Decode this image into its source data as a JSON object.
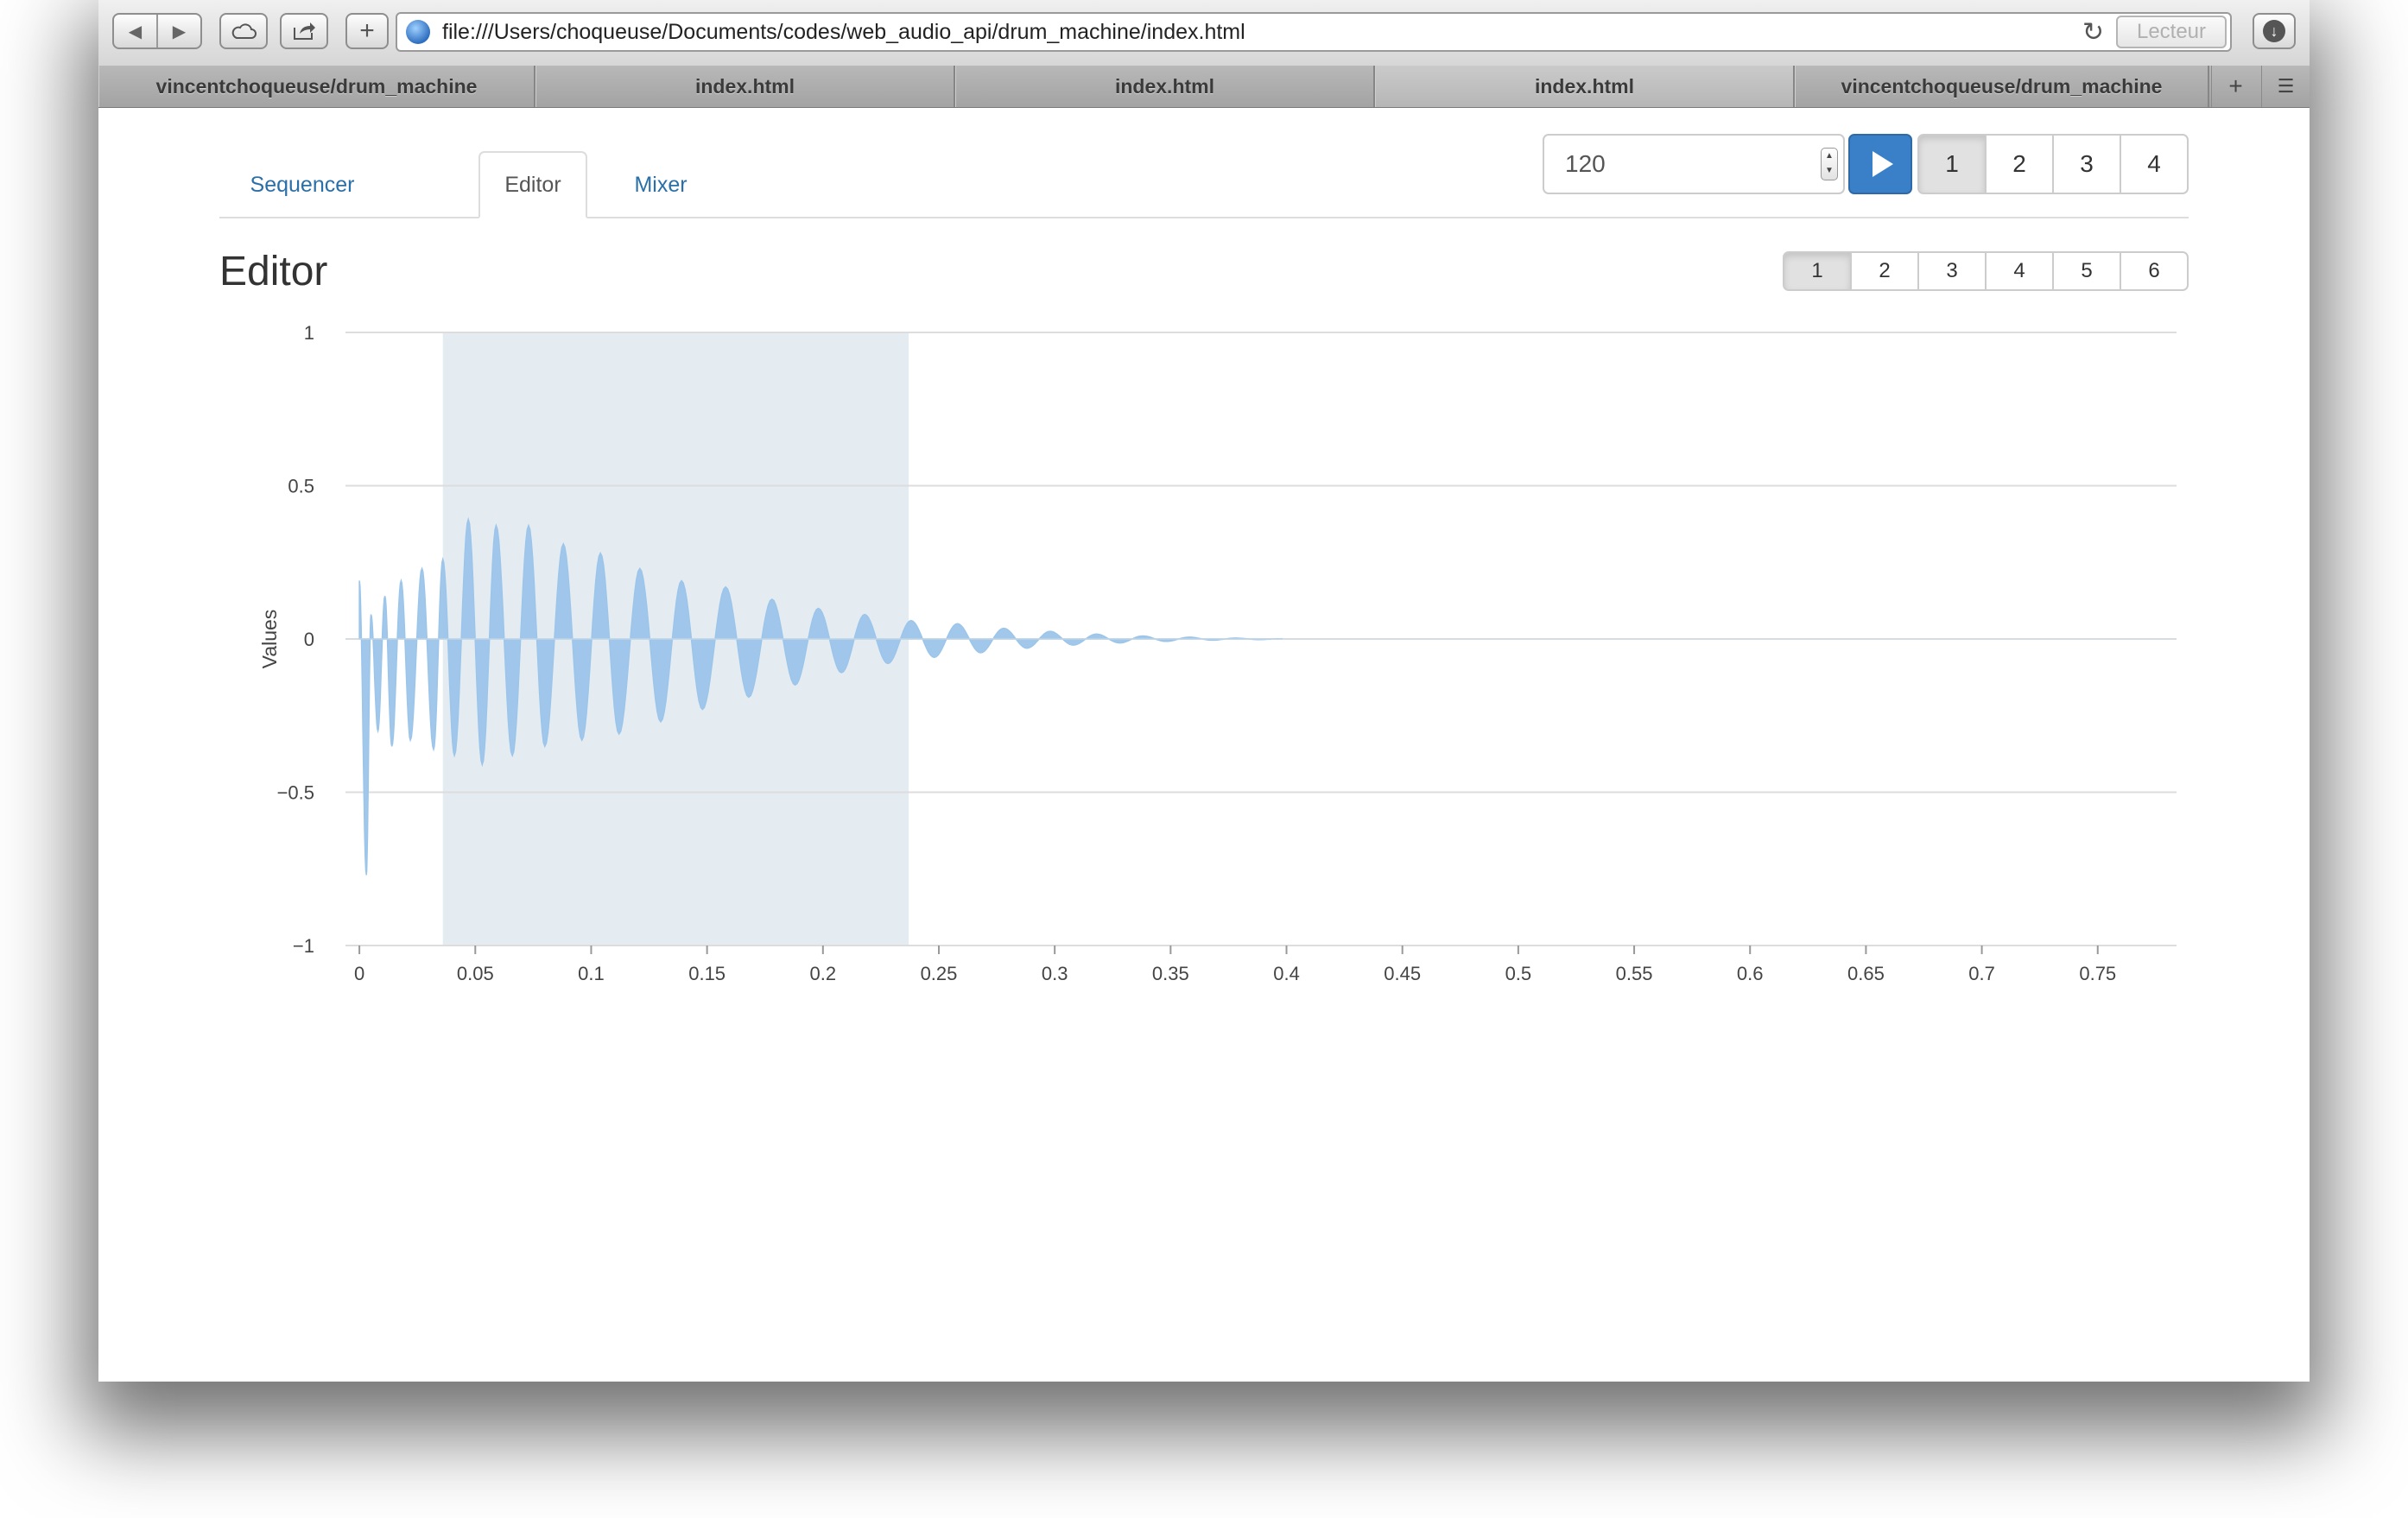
{
  "browser": {
    "address": "file:///Users/choqueuse/Documents/codes/web_audio_api/drum_machine/index.html",
    "reader_label": "Lecteur",
    "tabs": [
      {
        "label": "vincentchoqueuse/drum_machine",
        "active": false
      },
      {
        "label": "index.html",
        "active": false
      },
      {
        "label": "index.html",
        "active": false
      },
      {
        "label": "index.html",
        "active": true
      },
      {
        "label": "vincentchoqueuse/drum_machine",
        "active": false
      }
    ]
  },
  "nav": {
    "tabs": [
      {
        "label": "Sequencer",
        "active": false
      },
      {
        "label": "Editor",
        "active": true
      },
      {
        "label": "Mixer",
        "active": false
      }
    ]
  },
  "controls": {
    "tempo": "120",
    "patterns": [
      "1",
      "2",
      "3",
      "4"
    ],
    "active_pattern": "1",
    "sounds": [
      "1",
      "2",
      "3",
      "4",
      "5",
      "6"
    ],
    "active_sound": "1"
  },
  "editor": {
    "title": "Editor"
  },
  "chart_data": {
    "type": "area",
    "title": "",
    "xlabel": "",
    "ylabel": "Values",
    "xlim": [
      -0.006,
      0.784
    ],
    "ylim": [
      -1,
      1
    ],
    "xticks": [
      0,
      0.05,
      0.1,
      0.15,
      0.2,
      0.25,
      0.3,
      0.35,
      0.4,
      0.45,
      0.5,
      0.55,
      0.6,
      0.65,
      0.7,
      0.75
    ],
    "xtick_labels": [
      "0",
      "0.05",
      "0.1",
      "0.15",
      "0.2",
      "0.25",
      "0.3",
      "0.35",
      "0.4",
      "0.45",
      "0.5",
      "0.55",
      "0.6",
      "0.65",
      "0.7",
      "0.75"
    ],
    "yticks": [
      1,
      0.5,
      0,
      -0.5,
      -1
    ],
    "ytick_labels": [
      "1",
      "0.5",
      "0",
      "−0.5",
      "−1"
    ],
    "grid": "horizontal",
    "series_color": "#9cc5ea",
    "selection": {
      "x0": 0.036,
      "x1": 0.237,
      "color": "#e4ecf2"
    },
    "signal": {
      "x": [
        0,
        0.003,
        0.005,
        0.008,
        0.011,
        0.014,
        0.018,
        0.022,
        0.027,
        0.032,
        0.036,
        0.041,
        0.047,
        0.053,
        0.059,
        0.066,
        0.073,
        0.08,
        0.088,
        0.096,
        0.104,
        0.112,
        0.121,
        0.13,
        0.139,
        0.148,
        0.158,
        0.168,
        0.178,
        0.188,
        0.198,
        0.208,
        0.218,
        0.228,
        0.238,
        0.248,
        0.258,
        0.268,
        0.278,
        0.288,
        0.298,
        0.308,
        0.318,
        0.328,
        0.338,
        0.348,
        0.358,
        0.368,
        0.378,
        0.388,
        0.398
      ],
      "y": [
        0.19,
        -0.77,
        0.08,
        -0.3,
        0.14,
        -0.35,
        0.19,
        -0.33,
        0.23,
        -0.36,
        0.26,
        -0.38,
        0.39,
        -0.41,
        0.37,
        -0.38,
        0.37,
        -0.35,
        0.31,
        -0.33,
        0.28,
        -0.31,
        0.23,
        -0.27,
        0.19,
        -0.23,
        0.17,
        -0.19,
        0.13,
        -0.15,
        0.1,
        -0.11,
        0.08,
        -0.08,
        0.06,
        -0.06,
        0.05,
        -0.045,
        0.035,
        -0.03,
        0.025,
        -0.02,
        0.016,
        -0.013,
        0.01,
        -0.008,
        0.006,
        -0.004,
        0.003,
        -0.002,
        0.001
      ]
    }
  }
}
